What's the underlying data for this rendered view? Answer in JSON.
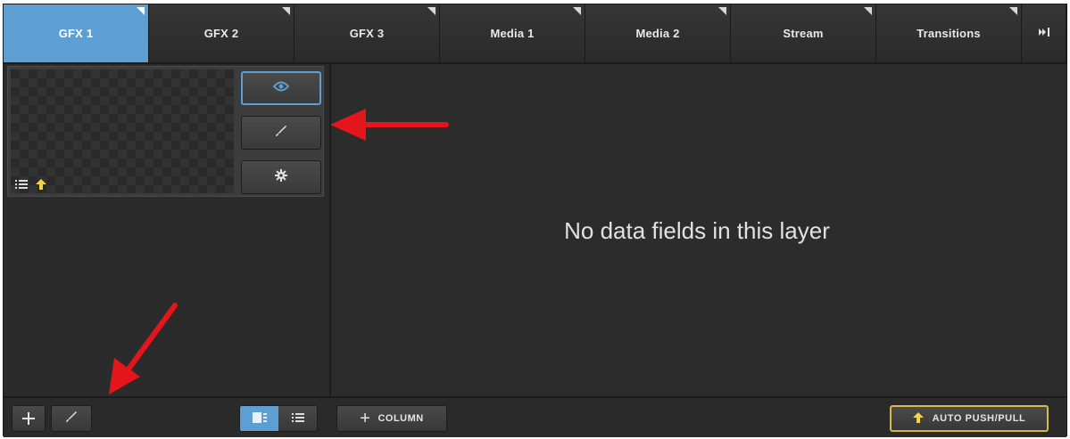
{
  "tabs": [
    {
      "label": "GFX 1",
      "active": true
    },
    {
      "label": "GFX 2",
      "active": false
    },
    {
      "label": "GFX 3",
      "active": false
    },
    {
      "label": "Media 1",
      "active": false
    },
    {
      "label": "Media 2",
      "active": false
    },
    {
      "label": "Stream",
      "active": false
    },
    {
      "label": "Transitions",
      "active": false
    }
  ],
  "tab_more_icon": "skip-to-end-icon",
  "layer": {
    "preview_button_icon": "eye-icon",
    "edit_button_icon": "brush-icon",
    "settings_button_icon": "gear-icon",
    "thumb_icons": [
      "list-icon",
      "arrow-up-icon"
    ]
  },
  "main": {
    "empty_message": "No data fields in this layer"
  },
  "bottom": {
    "add_icon": "plus-icon",
    "brush_icon": "brush-icon",
    "view_toggle": [
      "grid-view-icon",
      "list-view-icon"
    ],
    "add_column_label": "COLUMN",
    "auto_push_pull_label": "AUTO PUSH/PULL"
  },
  "colors": {
    "accent": "#5d9fd3",
    "background": "#2b2b2b",
    "highlight": "#d7b84a",
    "annotation": "#e4161b"
  }
}
